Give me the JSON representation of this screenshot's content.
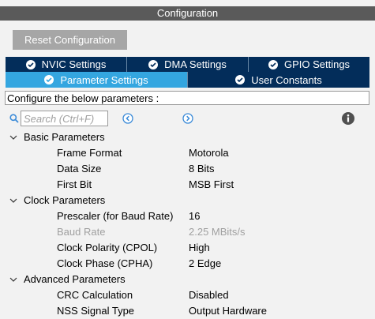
{
  "title": "Configuration",
  "reset_button": "Reset Configuration",
  "tabs_row1": [
    {
      "label": "NVIC Settings"
    },
    {
      "label": "DMA Settings"
    },
    {
      "label": "GPIO Settings"
    }
  ],
  "tabs_row2": [
    {
      "label": "Parameter Settings",
      "active": true
    },
    {
      "label": "User Constants"
    }
  ],
  "description": "Configure the below parameters :",
  "search": {
    "placeholder": "Search (Ctrl+F)",
    "value": ""
  },
  "colors": {
    "tab_dark": "#032d5a",
    "tab_active": "#34a6e0",
    "title_bar": "#5a5a5a",
    "button": "#a6a6a6",
    "nav_blue": "#3a8ad8"
  },
  "groups": [
    {
      "name": "Basic Parameters",
      "params": [
        {
          "name": "Frame Format",
          "value": "Motorola"
        },
        {
          "name": "Data Size",
          "value": "8 Bits"
        },
        {
          "name": "First Bit",
          "value": "MSB First"
        }
      ]
    },
    {
      "name": "Clock Parameters",
      "params": [
        {
          "name": "Prescaler (for Baud Rate)",
          "value": "16"
        },
        {
          "name": "Baud Rate",
          "value": "2.25 MBits/s",
          "disabled": true
        },
        {
          "name": "Clock Polarity (CPOL)",
          "value": "High"
        },
        {
          "name": "Clock Phase (CPHA)",
          "value": "2 Edge"
        }
      ]
    },
    {
      "name": "Advanced Parameters",
      "params": [
        {
          "name": "CRC Calculation",
          "value": "Disabled"
        },
        {
          "name": "NSS Signal Type",
          "value": "Output Hardware"
        }
      ]
    }
  ]
}
